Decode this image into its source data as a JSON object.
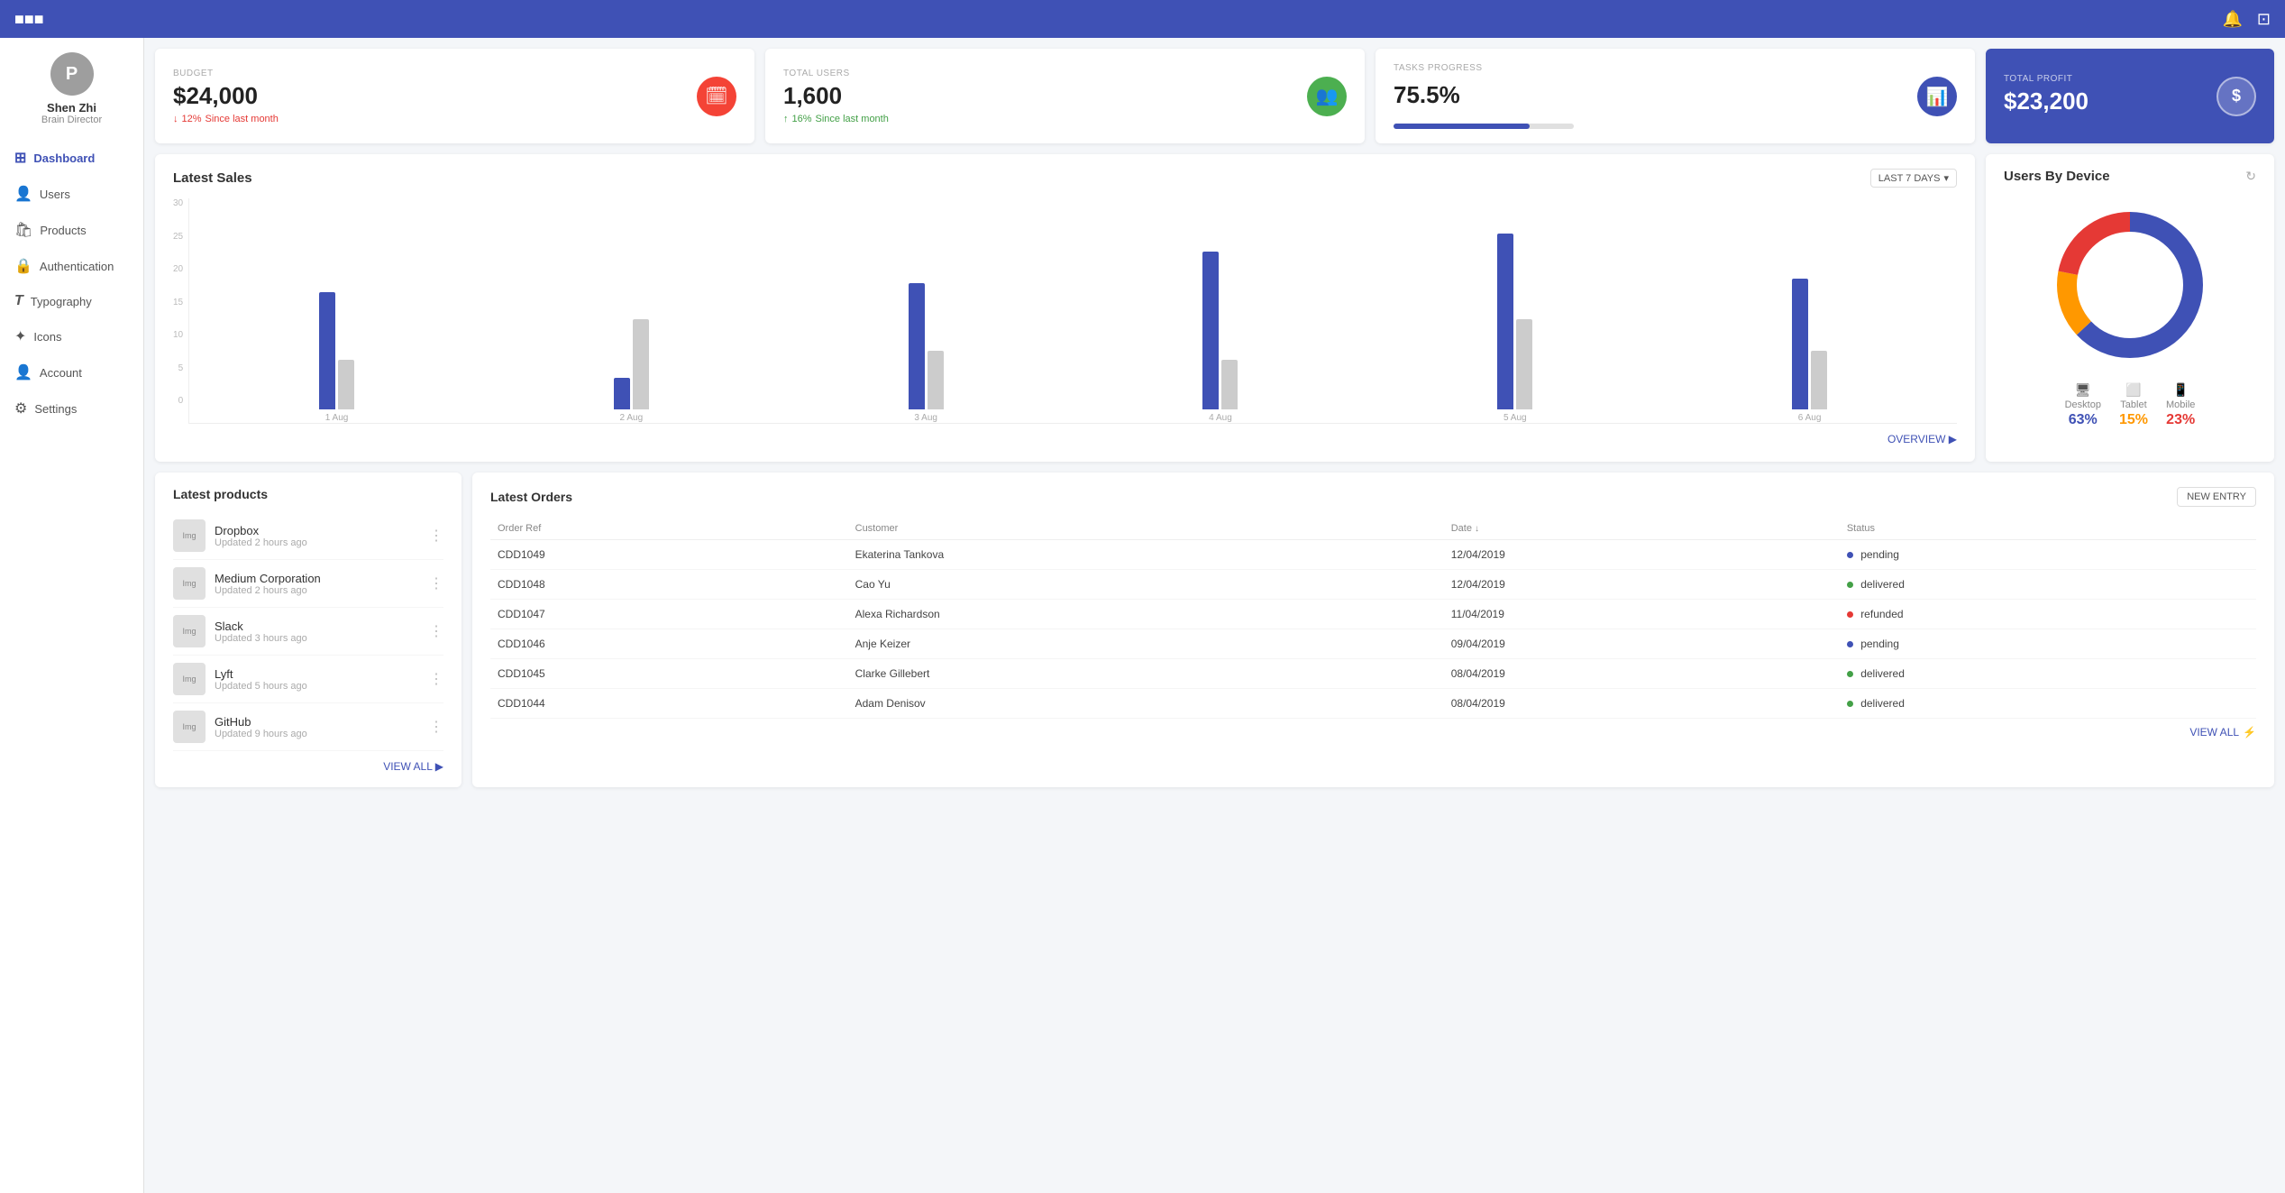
{
  "topbar": {
    "logo": "logo",
    "notification_icon": "🔔",
    "screen_icon": "🖥"
  },
  "sidebar": {
    "user": {
      "initial": "P",
      "name": "Shen Zhi",
      "role": "Brain Director"
    },
    "items": [
      {
        "id": "dashboard",
        "label": "Dashboard",
        "icon": "⊞",
        "active": true
      },
      {
        "id": "users",
        "label": "Users",
        "icon": "👤"
      },
      {
        "id": "products",
        "label": "Products",
        "icon": "🛍"
      },
      {
        "id": "authentication",
        "label": "Authentication",
        "icon": "🔒"
      },
      {
        "id": "typography",
        "label": "Typography",
        "icon": "T"
      },
      {
        "id": "icons",
        "label": "Icons",
        "icon": "✦"
      },
      {
        "id": "account",
        "label": "Account",
        "icon": "👤"
      },
      {
        "id": "settings",
        "label": "Settings",
        "icon": "⚙"
      }
    ]
  },
  "stats": {
    "budget": {
      "label": "BUDGET",
      "value": "$24,000",
      "change": "12%",
      "change_direction": "down",
      "change_text": "Since last month",
      "icon": "🗓",
      "icon_bg": "#f44336"
    },
    "total_users": {
      "label": "TOTAL USERS",
      "value": "1,600",
      "change": "16%",
      "change_direction": "up",
      "change_text": "Since last month",
      "icon": "👥",
      "icon_bg": "#4caf50"
    },
    "tasks_progress": {
      "label": "TASKS PROGRESS",
      "value": "75.5%",
      "progress": 75.5,
      "icon": "📊",
      "icon_bg": "#3f51b5"
    },
    "total_profit": {
      "label": "TOTAL PROFIT",
      "value": "$23,200",
      "icon": "$",
      "icon_bg": "rgba(255,255,255,0.2)"
    }
  },
  "sales_chart": {
    "title": "Latest Sales",
    "filter": "LAST 7 DAYS",
    "overview_link": "OVERVIEW",
    "y_labels": [
      "30",
      "25",
      "20",
      "15",
      "10",
      "5",
      "0"
    ],
    "bars": [
      {
        "label": "1 Aug",
        "blue_height": 130,
        "gray_height": 55
      },
      {
        "label": "2 Aug",
        "blue_height": 35,
        "gray_height": 100
      },
      {
        "label": "3 Aug",
        "blue_height": 140,
        "gray_height": 65
      },
      {
        "label": "4 Aug",
        "blue_height": 175,
        "gray_height": 55
      },
      {
        "label": "5 Aug",
        "blue_height": 195,
        "gray_height": 100
      },
      {
        "label": "6 Aug",
        "blue_height": 145,
        "gray_height": 65
      }
    ]
  },
  "donut_chart": {
    "title": "Users By Device",
    "legend": [
      {
        "device": "Desktop",
        "icon": "🖥",
        "value": "63%",
        "color": "blue"
      },
      {
        "device": "Tablet",
        "icon": "📱",
        "value": "15%",
        "color": "orange"
      },
      {
        "device": "Mobile",
        "icon": "📱",
        "value": "23%",
        "color": "red"
      }
    ]
  },
  "products": {
    "title": "Latest products",
    "view_all": "VIEW ALL",
    "items": [
      {
        "name": "Dropbox",
        "updated": "Updated 2 hours ago"
      },
      {
        "name": "Medium Corporation",
        "updated": "Updated 2 hours ago"
      },
      {
        "name": "Slack",
        "updated": "Updated 3 hours ago"
      },
      {
        "name": "Lyft",
        "updated": "Updated 5 hours ago"
      },
      {
        "name": "GitHub",
        "updated": "Updated 9 hours ago"
      }
    ]
  },
  "orders": {
    "title": "Latest Orders",
    "new_entry": "NEW ENTRY",
    "columns": [
      "Order Ref",
      "Customer",
      "Date",
      "Status"
    ],
    "view_all": "VIEW ALL",
    "rows": [
      {
        "ref": "CDD1049",
        "customer": "Ekaterina Tankova",
        "date": "12/04/2019",
        "status": "pending",
        "status_label": "pending"
      },
      {
        "ref": "CDD1048",
        "customer": "Cao Yu",
        "date": "12/04/2019",
        "status": "delivered",
        "status_label": "delivered"
      },
      {
        "ref": "CDD1047",
        "customer": "Alexa Richardson",
        "date": "11/04/2019",
        "status": "refunded",
        "status_label": "refunded"
      },
      {
        "ref": "CDD1046",
        "customer": "Anje Keizer",
        "date": "09/04/2019",
        "status": "pending",
        "status_label": "pending"
      },
      {
        "ref": "CDD1045",
        "customer": "Clarke Gillebert",
        "date": "08/04/2019",
        "status": "delivered",
        "status_label": "delivered"
      },
      {
        "ref": "CDD1044",
        "customer": "Adam Denisov",
        "date": "08/04/2019",
        "status": "delivered",
        "status_label": "delivered"
      }
    ]
  }
}
